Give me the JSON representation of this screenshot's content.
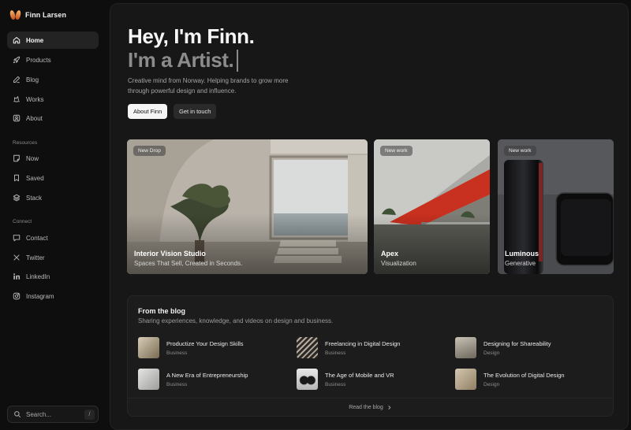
{
  "brand": {
    "name": "Finn Larsen"
  },
  "nav": {
    "main": [
      {
        "label": "Home",
        "icon": "home-icon",
        "active": true
      },
      {
        "label": "Products",
        "icon": "rocket-icon"
      },
      {
        "label": "Blog",
        "icon": "pen-icon"
      },
      {
        "label": "Works",
        "icon": "works-icon"
      },
      {
        "label": "About",
        "icon": "user-square-icon"
      }
    ],
    "resources_label": "Resources",
    "resources": [
      {
        "label": "Now",
        "icon": "note-icon"
      },
      {
        "label": "Saved",
        "icon": "bookmark-icon"
      },
      {
        "label": "Stack",
        "icon": "layers-icon"
      }
    ],
    "connect_label": "Connect",
    "connect": [
      {
        "label": "Contact",
        "icon": "chat-icon"
      },
      {
        "label": "Twitter",
        "icon": "x-icon"
      },
      {
        "label": "LinkedIn",
        "icon": "linkedin-icon"
      },
      {
        "label": "Instagram",
        "icon": "instagram-icon"
      }
    ]
  },
  "search": {
    "placeholder": "Search...",
    "shortcut": "/"
  },
  "hero": {
    "title": "Hey, I'm Finn.",
    "subtitle": "I'm a Artist.",
    "description": "Creative mind from Norway. Helping brands to grow more through powerful design and influence.",
    "primary_button": "About Finn",
    "secondary_button": "Get in touch"
  },
  "cards": [
    {
      "badge": "New Drop",
      "title": "Interior Vision Studio",
      "subtitle": "Spaces That Sell, Created in Seconds."
    },
    {
      "badge": "New work",
      "title": "Apex",
      "subtitle": "Visualization"
    },
    {
      "badge": "New work",
      "title": "Luminous",
      "subtitle": "Generative"
    }
  ],
  "blog": {
    "title": "From the blog",
    "subtitle": "Sharing experiences, knowledge, and videos on design and business.",
    "posts": [
      {
        "title": "Productize Your Design Skills",
        "category": "Business"
      },
      {
        "title": "Freelancing in Digital Design",
        "category": "Business"
      },
      {
        "title": "Designing for Shareability",
        "category": "Design"
      },
      {
        "title": "A New Era of Entrepreneurship",
        "category": "Business"
      },
      {
        "title": "The Age of Mobile and VR",
        "category": "Business"
      },
      {
        "title": "The Evolution of Digital Design",
        "category": "Design"
      }
    ],
    "read_more": "Read the blog"
  },
  "colors": {
    "background": "#0e0e0e",
    "panel": "#171717",
    "accent": "#c5501c"
  }
}
